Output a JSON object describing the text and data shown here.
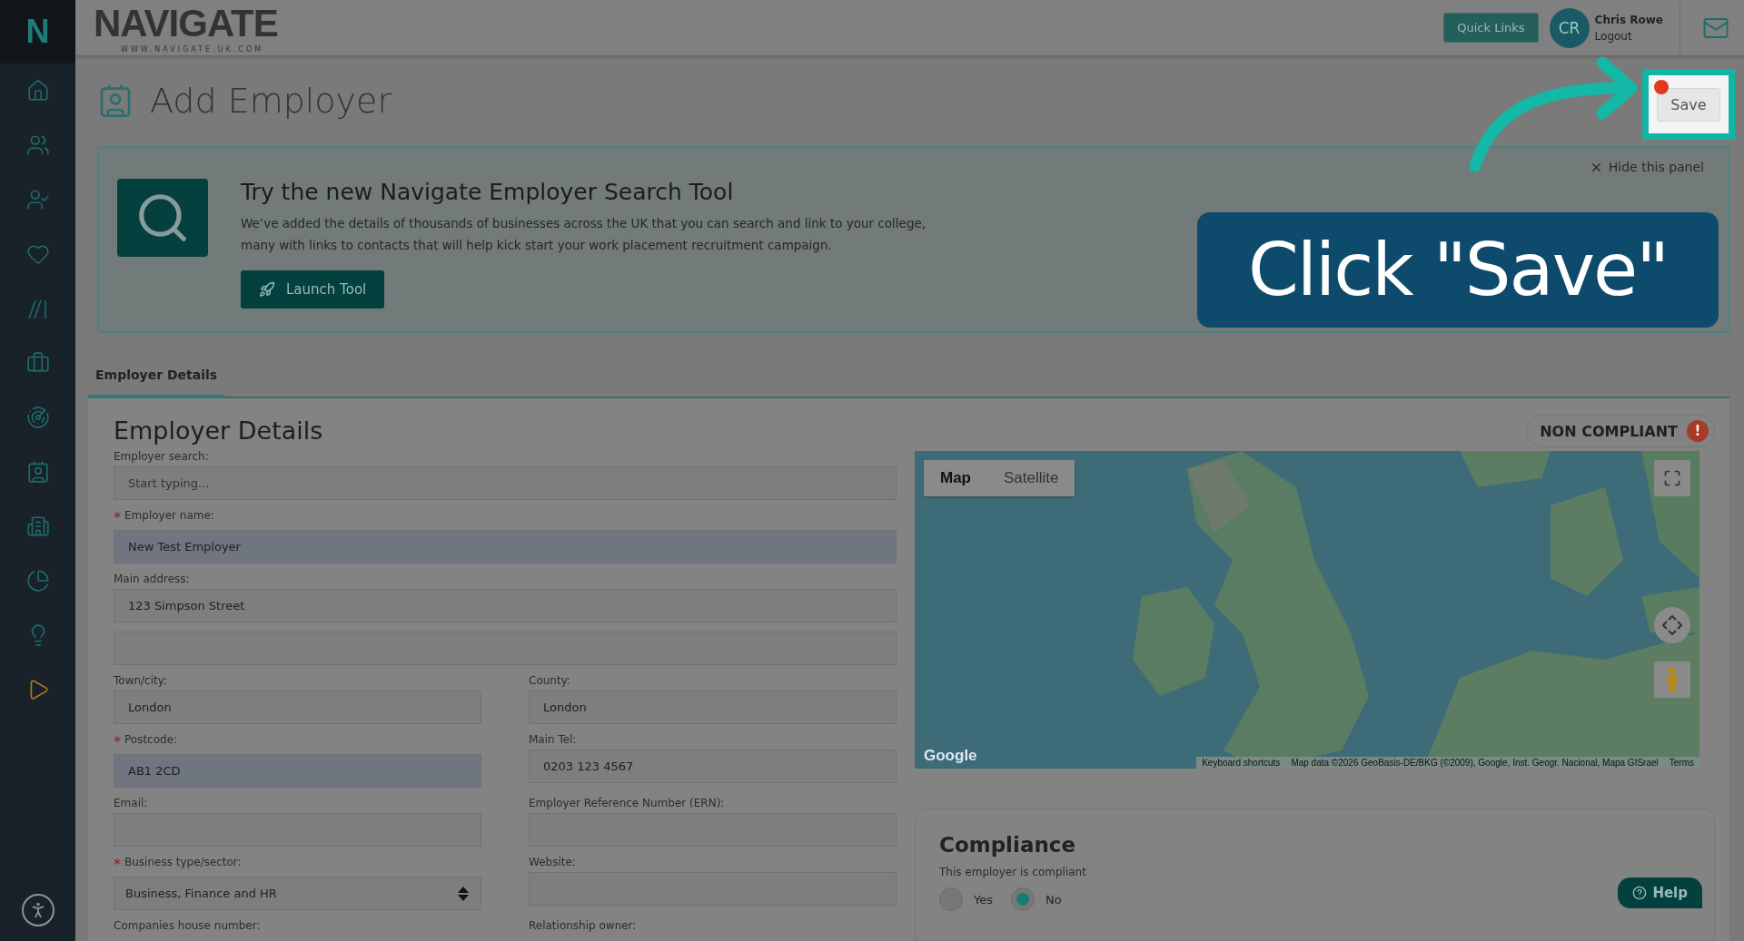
{
  "brand": {
    "mark": "N",
    "logo": "NAVIGATE",
    "logo_sub": "WWW.NAVIGATE.UK.COM"
  },
  "sidebar": {
    "items": [
      {
        "kind": "home"
      },
      {
        "kind": "users"
      },
      {
        "kind": "user"
      },
      {
        "kind": "heart"
      },
      {
        "kind": "slashes"
      },
      {
        "kind": "briefcase"
      },
      {
        "kind": "radar"
      },
      {
        "kind": "contact"
      },
      {
        "kind": "building"
      },
      {
        "kind": "pie"
      },
      {
        "kind": "bulb"
      },
      {
        "kind": "play"
      }
    ]
  },
  "header": {
    "quick_links": "Quick Links",
    "avatar": "CR",
    "user_name": "Chris Rowe",
    "logout": "Logout"
  },
  "page": {
    "title": "Add Employer",
    "save": "Save"
  },
  "banner": {
    "title": "Try the new Navigate Employer Search Tool",
    "text": "We’ve added the details of thousands of businesses across the UK that you can search and link to your college, many with links to contacts that will help kick start your work placement recruitment campaign.",
    "button": "Launch Tool",
    "hide": "Hide this panel"
  },
  "annotation": {
    "text": "Click \"Save\""
  },
  "tabs": [
    {
      "label": "Employer Details",
      "selected": true
    }
  ],
  "form": {
    "title": "Employer Details",
    "status": "NON COMPLIANT",
    "status_mark": "!",
    "rows": [
      [
        {
          "kind": "text",
          "label": "Employer search:",
          "placeholder": "Start typing...",
          "autofilled": false
        }
      ],
      [
        {
          "kind": "text",
          "mark": "*",
          "label": "Employer name:",
          "value": "New Test Employer",
          "autofilled": true
        }
      ],
      [
        {
          "kind": "text",
          "label": "Main address:",
          "value": "123 Simpson Street",
          "autofilled": false
        }
      ],
      [
        {
          "kind": "text",
          "autofilled": false
        }
      ],
      [
        {
          "kind": "text",
          "label": "Town/city:",
          "value": "London",
          "autofilled": false
        },
        {
          "kind": "text",
          "label": "County:",
          "value": "London",
          "autofilled": false
        }
      ],
      [
        {
          "kind": "text",
          "mark": "*",
          "label": "Postcode:",
          "value": "AB1 2CD",
          "autofilled": true
        },
        {
          "kind": "text",
          "label": "Main Tel:",
          "value": "0203 123 4567",
          "autofilled": false
        }
      ],
      [
        {
          "kind": "text",
          "label": "Email:",
          "autofilled": false
        },
        {
          "kind": "text",
          "label": "Employer Reference Number (ERN):",
          "autofilled": false
        }
      ],
      [
        {
          "kind": "select",
          "mark": "*",
          "label": "Business type/sector:",
          "value": "Business, Finance and HR",
          "autofilled": false
        },
        {
          "kind": "text",
          "label": "Website:",
          "autofilled": false
        }
      ],
      [
        {
          "kind": "cut",
          "label": "Companies house number:"
        },
        {
          "kind": "cut",
          "label": "Relationship owner:"
        }
      ]
    ]
  },
  "map": {
    "types": [
      {
        "label": "Map",
        "selected": true
      },
      {
        "label": "Satellite",
        "selected": false
      }
    ],
    "logo": "Google",
    "keyboard": "Keyboard shortcuts",
    "attribution": "Map data ©2026 GeoBasis-DE/BKG (©2009), Google, Inst. Geogr. Nacional, Mapa GISrael",
    "terms": "Terms"
  },
  "compliance": {
    "title": "Compliance",
    "question": "This employer is compliant",
    "options": [
      {
        "label": "Yes",
        "selected": false
      },
      {
        "label": "No",
        "selected": true
      }
    ]
  },
  "help": "Help"
}
